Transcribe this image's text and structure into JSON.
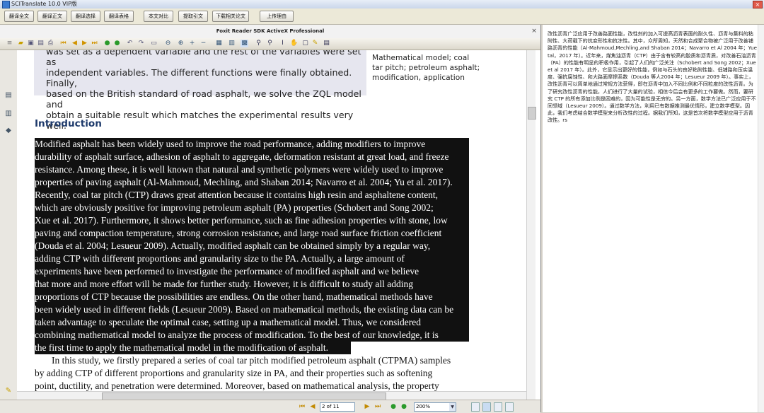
{
  "window": {
    "title": "SCITranslate 10.0 VIP版"
  },
  "top_buttons": [
    {
      "id": "translate-full",
      "label": "翻译全文"
    },
    {
      "id": "translate-main",
      "label": "翻译正文"
    },
    {
      "id": "translate-selection",
      "label": "翻译选择"
    },
    {
      "id": "translate-table",
      "label": "翻译表格"
    },
    {
      "id": "text-compare",
      "label": "本文对比"
    },
    {
      "id": "extract-refs",
      "label": "提取引文"
    },
    {
      "id": "download-related",
      "label": "下载相关论文"
    },
    {
      "id": "upload-feedback",
      "label": "上传理由"
    }
  ],
  "reader": {
    "title": "Foxit Reader SDK ActiveX Professional",
    "close": "×"
  },
  "document": {
    "abstract_lines": [
      "was set as a dependent variable and the rest of the variables were set as",
      "independent variables. The different functions were finally obtained. Finally,",
      "based on the British standard of road asphalt, we solve the ZQL model and",
      "obtain a suitable result which matches the experimental results very well."
    ],
    "keywords_lines": [
      "Mathematical model; coal",
      "tar pitch; petroleum asphalt;",
      "modification, application"
    ],
    "heading": "Introduction",
    "selected_lines": [
      "Modified asphalt has been widely used to improve the road performance, adding modifiers to improve",
      "durability of asphalt surface, adhesion of asphalt to aggregate, deformation resistant at great load, and freeze",
      "resistance. Among these, it is well known that natural and synthetic polymers were widely used to improve",
      "properties of paving asphalt (Al-Mahmoud, Mechling, and Shaban 2014; Navarro et al. 2004; Yu et al. 2017).",
      "Recently, coal tar pitch (CTP) draws great attention because it contains high resin and asphaltene content,",
      "which are obviously positive for improving petroleum asphalt (PA) properties (Schobert and Song 2002;",
      "Xue et al. 2017). Furthermore, it shows better performance, such as fine adhesion properties with stone, low",
      "paving and compaction temperature, strong corrosion resistance, and large road surface friction coefficient",
      "(Douda et al. 2004; Lesueur 2009). Actually, modified asphalt can be obtained simply by a regular way,",
      "adding CTP with different proportions and granularity size to the PA. Actually, a large amount of",
      "experiments have been performed to investigate the performance of modified asphalt and we believe",
      "that more and more effort will be made for further study. However, it is difficult to study all adding",
      "proportions of CTP because the possibilities are endless. On the other hand, mathematical methods have",
      "been widely used in different fields (Lesueur 2009). Based on mathematical methods, the existing data can be",
      "taken advantage to speculate the optimal case, setting up a mathematical model. Thus, we considered",
      "combining mathematical model to analyze the process of modification. To the best of our knowledge, it is",
      "the first time to apply the mathematical model in the modification of asphalt."
    ],
    "plain_lines": [
      "In this study, we firstly prepared a series of coal tar pitch modified petroleum asphalt (CTPMA) samples",
      "by adding CTP of different proportions and granularity size in PA, and their properties such as softening",
      "point, ductility, and penetration were determined. Moreover, based on mathematical analysis, the property"
    ]
  },
  "status": {
    "page_display": "2 of 11",
    "zoom": "200%"
  },
  "translation": {
    "text": "改性沥青广泛应用于改善路面性能，改性剂的加入可提高沥青表面的耐久性、沥青与集料的粘附性、大荷载下的抗变形性和抗冻性。其中，众所周知，天然和合成聚合物被广泛用于改善铺路沥青的性能（Al-Mahmoud,Mechling,and Shaban 2014；Navarro et Al 2004 年；Yuetal，2017 年）。近年来，煤焦油沥青（CTP）由于含有较高的胶质和沥青质，对改善石油沥青（PA）的性能有明显的积极作用，引起了人们的广泛关注（Schobert and Song 2002；Xue et al 2017 年）。此外，它显示出更好的性能，例如与石头的良好粘附性能、低铺路和压实温度、强抗腐蚀性、和大路面摩擦系数（Douda 等人2004 年；Lesueur 2009 年）。事实上，改性沥青可以简单地通过常规方法获得，即在沥青中加入不同比例和不同粒度的改性沥青。为了研究改性沥青的性能，人们进行了大量的试验，相信今后会有更多的工作要做。然而，要研究 CTP 的所有添加比例是困难的，因为可能性是无穷的。另一方面，数学方法已广泛应用于不同领域（Lesueur 2009）。通过数学方法，利用已有数据推测最优情形，建立数学模型。因此，我们考虑结合数学模型来分析改性的过程。据我们所知，这是首次将数学模型应用于沥青改性。rs"
  }
}
